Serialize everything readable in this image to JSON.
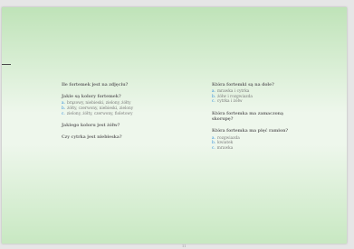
{
  "left": {
    "q1": "Ile fortemek jest na zdjęciu?",
    "block": {
      "question": "Jakie są kolory fortemek?",
      "options": [
        {
          "letter": "a.",
          "text": "brązowy, niebieski, zielony, żółty"
        },
        {
          "letter": "b.",
          "text": "żółty, czerwony, niebieski, zielony"
        },
        {
          "letter": "c.",
          "text": "zielony, żółty, czerwony, fioletowy"
        }
      ]
    },
    "q2": "Jakiego koloru jest żółw?",
    "q3": "Czy cytrka jest niebieska?"
  },
  "right": {
    "block1": {
      "question": "Która fortemki są na dole?",
      "options": [
        {
          "letter": "a.",
          "text": "mrawka i cytrka"
        },
        {
          "letter": "b.",
          "text": "żółw i rozgwiazda"
        },
        {
          "letter": "c.",
          "text": "cytrka i żółw"
        }
      ]
    },
    "q_line1": "Która fortemka ma zamaczoną",
    "q_line2": "skorupę?",
    "block2": {
      "question": "Która fortemka ma pięć ramion?",
      "options": [
        {
          "letter": "a.",
          "text": "rozgwiazda"
        },
        {
          "letter": "b.",
          "text": "kwiatek"
        },
        {
          "letter": "c.",
          "text": "mrawka"
        }
      ]
    }
  },
  "page_number": "11"
}
